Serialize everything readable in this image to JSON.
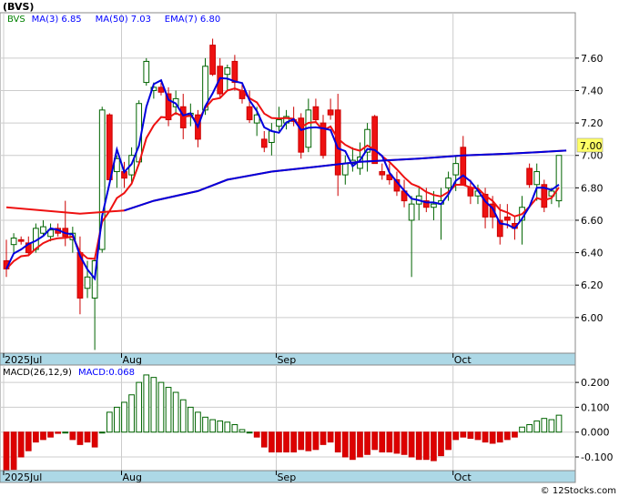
{
  "chart_data": [
    {
      "type": "candlestick",
      "title": "(BVS)",
      "legend": [
        {
          "name": "BVS",
          "value": "",
          "color": "#008000"
        },
        {
          "name": "MA(3)",
          "value": "6.85",
          "color": "#0000ff"
        },
        {
          "name": "MA(50)",
          "value": "7.03",
          "color": "#0000ff"
        },
        {
          "name": "EMA(7)",
          "value": "6.80",
          "color": "#0000ff"
        }
      ],
      "legend_placement": "top-left",
      "price_axis": {
        "ticks": [
          "7.60",
          "7.40",
          "7.20",
          "7.00",
          "6.80",
          "6.60",
          "6.40",
          "6.20",
          "6.00"
        ],
        "tick_values": [
          7.6,
          7.4,
          7.2,
          7.0,
          6.8,
          6.6,
          6.4,
          6.2,
          6.0
        ],
        "ylim": [
          5.78,
          7.88
        ]
      },
      "last_price_label": "7.00",
      "x_labels": [
        {
          "label": "2025Jul",
          "index": 0
        },
        {
          "label": "Aug",
          "index": 16
        },
        {
          "label": "Sep",
          "index": 37
        },
        {
          "label": "Oct",
          "index": 61
        }
      ],
      "grid": true,
      "candles": [
        [
          6.35,
          6.48,
          6.25,
          6.3
        ],
        [
          6.45,
          6.52,
          6.4,
          6.49
        ],
        [
          6.48,
          6.5,
          6.45,
          6.47
        ],
        [
          6.46,
          6.5,
          6.38,
          6.4
        ],
        [
          6.42,
          6.58,
          6.4,
          6.55
        ],
        [
          6.52,
          6.6,
          6.5,
          6.56
        ],
        [
          6.5,
          6.58,
          6.47,
          6.54
        ],
        [
          6.55,
          6.58,
          6.5,
          6.52
        ],
        [
          6.55,
          6.72,
          6.44,
          6.5
        ],
        [
          6.48,
          6.56,
          6.4,
          6.52
        ],
        [
          6.4,
          6.5,
          6.02,
          6.12
        ],
        [
          6.18,
          6.35,
          6.12,
          6.25
        ],
        [
          6.12,
          6.36,
          5.8,
          6.35
        ],
        [
          6.42,
          7.3,
          6.4,
          7.28
        ],
        [
          7.25,
          7.26,
          6.85,
          6.85
        ],
        [
          6.9,
          7.0,
          6.8,
          6.98
        ],
        [
          6.9,
          6.96,
          6.8,
          6.86
        ],
        [
          6.88,
          7.05,
          6.82,
          7.0
        ],
        [
          6.96,
          7.34,
          6.94,
          7.32
        ],
        [
          7.45,
          7.6,
          7.43,
          7.58
        ],
        [
          7.4,
          7.45,
          7.35,
          7.42
        ],
        [
          7.42,
          7.45,
          7.37,
          7.39
        ],
        [
          7.38,
          7.42,
          7.18,
          7.22
        ],
        [
          7.3,
          7.4,
          7.25,
          7.35
        ],
        [
          7.3,
          7.38,
          7.1,
          7.17
        ],
        [
          7.25,
          7.32,
          7.18,
          7.26
        ],
        [
          7.25,
          7.28,
          7.05,
          7.1
        ],
        [
          7.28,
          7.6,
          7.25,
          7.55
        ],
        [
          7.68,
          7.72,
          7.49,
          7.5
        ],
        [
          7.55,
          7.6,
          7.35,
          7.38
        ],
        [
          7.5,
          7.56,
          7.4,
          7.54
        ],
        [
          7.58,
          7.62,
          7.4,
          7.45
        ],
        [
          7.4,
          7.45,
          7.32,
          7.35
        ],
        [
          7.3,
          7.4,
          7.2,
          7.22
        ],
        [
          7.2,
          7.3,
          7.12,
          7.25
        ],
        [
          7.1,
          7.15,
          7.02,
          7.05
        ],
        [
          7.08,
          7.2,
          7.0,
          7.15
        ],
        [
          7.18,
          7.3,
          7.15,
          7.22
        ],
        [
          7.2,
          7.28,
          7.16,
          7.24
        ],
        [
          7.22,
          7.3,
          7.18,
          7.21
        ],
        [
          7.23,
          7.26,
          6.98,
          7.02
        ],
        [
          7.05,
          7.35,
          7.02,
          7.28
        ],
        [
          7.3,
          7.35,
          7.2,
          7.22
        ],
        [
          7.2,
          7.25,
          6.98,
          7.0
        ],
        [
          7.28,
          7.35,
          7.22,
          7.25
        ],
        [
          7.28,
          7.38,
          6.75,
          6.88
        ],
        [
          6.88,
          7.0,
          6.82,
          6.95
        ],
        [
          6.95,
          7.05,
          6.9,
          6.97
        ],
        [
          6.92,
          7.08,
          6.88,
          6.99
        ],
        [
          7.02,
          7.2,
          6.9,
          7.16
        ],
        [
          7.24,
          7.25,
          6.95,
          6.95
        ],
        [
          6.9,
          6.95,
          6.85,
          6.88
        ],
        [
          6.88,
          6.95,
          6.82,
          6.85
        ],
        [
          6.85,
          6.9,
          6.75,
          6.78
        ],
        [
          6.78,
          6.85,
          6.68,
          6.72
        ],
        [
          6.6,
          6.75,
          6.25,
          6.7
        ],
        [
          6.7,
          6.8,
          6.6,
          6.75
        ],
        [
          6.72,
          6.8,
          6.65,
          6.68
        ],
        [
          6.68,
          6.78,
          6.6,
          6.7
        ],
        [
          6.7,
          6.8,
          6.48,
          6.72
        ],
        [
          6.8,
          6.9,
          6.72,
          6.86
        ],
        [
          6.88,
          7.0,
          6.78,
          6.95
        ],
        [
          7.05,
          7.12,
          6.82,
          6.82
        ],
        [
          6.8,
          6.85,
          6.7,
          6.75
        ],
        [
          6.75,
          6.82,
          6.7,
          6.78
        ],
        [
          6.76,
          6.8,
          6.55,
          6.62
        ],
        [
          6.7,
          6.75,
          6.55,
          6.62
        ],
        [
          6.6,
          6.7,
          6.45,
          6.5
        ],
        [
          6.62,
          6.7,
          6.55,
          6.6
        ],
        [
          6.58,
          6.62,
          6.48,
          6.55
        ],
        [
          6.6,
          6.75,
          6.45,
          6.68
        ],
        [
          6.92,
          6.95,
          6.8,
          6.82
        ],
        [
          6.82,
          6.95,
          6.72,
          6.9
        ],
        [
          6.82,
          6.85,
          6.65,
          6.68
        ],
        [
          6.75,
          6.8,
          6.7,
          6.78
        ],
        [
          6.72,
          7.0,
          6.68,
          7.0
        ]
      ],
      "ma50": [
        [
          0,
          6.68
        ],
        [
          10,
          6.64
        ],
        [
          16,
          6.66
        ],
        [
          20,
          6.72
        ],
        [
          26,
          6.78
        ],
        [
          30,
          6.85
        ],
        [
          36,
          6.9
        ],
        [
          42,
          6.93
        ],
        [
          48,
          6.96
        ],
        [
          56,
          6.98
        ],
        [
          62,
          7.0
        ],
        [
          68,
          7.01
        ],
        [
          72,
          7.02
        ],
        [
          76,
          7.03
        ]
      ]
    },
    {
      "type": "bar",
      "title": "MACD(26,12,9)",
      "value_label": "MACD:0.068",
      "axis": {
        "ticks": [
          "0.200",
          "0.100",
          "0.000",
          "-0.100"
        ],
        "tick_values": [
          0.2,
          0.1,
          0.0,
          -0.1
        ],
        "ylim": [
          -0.155,
          0.27
        ]
      },
      "values": [
        -0.16,
        -0.15,
        -0.1,
        -0.075,
        -0.04,
        -0.03,
        -0.02,
        -0.005,
        0.0,
        -0.03,
        -0.05,
        -0.04,
        -0.06,
        0.0,
        0.08,
        0.1,
        0.12,
        0.15,
        0.2,
        0.23,
        0.22,
        0.2,
        0.18,
        0.16,
        0.13,
        0.1,
        0.08,
        0.06,
        0.05,
        0.045,
        0.04,
        0.03,
        0.01,
        0.0,
        -0.02,
        -0.06,
        -0.08,
        -0.08,
        -0.08,
        -0.08,
        -0.07,
        -0.075,
        -0.07,
        -0.05,
        -0.04,
        -0.08,
        -0.1,
        -0.11,
        -0.1,
        -0.09,
        -0.07,
        -0.08,
        -0.08,
        -0.085,
        -0.09,
        -0.1,
        -0.11,
        -0.11,
        -0.115,
        -0.095,
        -0.07,
        -0.03,
        -0.02,
        -0.025,
        -0.03,
        -0.04,
        -0.045,
        -0.04,
        -0.03,
        -0.02,
        0.02,
        0.03,
        0.045,
        0.055,
        0.05,
        0.068
      ]
    }
  ],
  "footer": {
    "credit": "© 12Stocks.com"
  }
}
